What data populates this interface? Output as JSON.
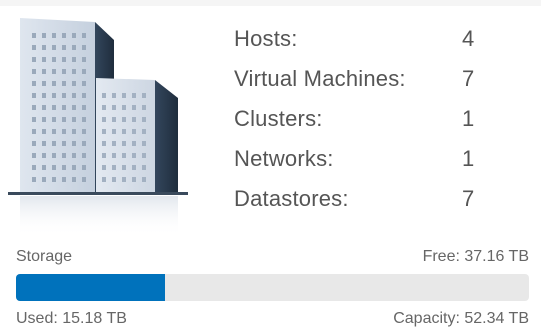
{
  "summary": {
    "stats": [
      {
        "label": "Hosts:",
        "value": "4"
      },
      {
        "label": "Virtual Machines:",
        "value": "7"
      },
      {
        "label": "Clusters:",
        "value": "1"
      },
      {
        "label": "Networks:",
        "value": "1"
      },
      {
        "label": "Datastores:",
        "value": "7"
      }
    ]
  },
  "storage": {
    "label": "Storage",
    "free": "Free: 37.16 TB",
    "used": "Used: 15.18 TB",
    "capacity": "Capacity: 52.34 TB",
    "used_fraction": 0.29,
    "bar_color": "#0072bc",
    "track_color": "#e8e8e8"
  },
  "icon": {
    "name": "datacenter-buildings-icon"
  }
}
